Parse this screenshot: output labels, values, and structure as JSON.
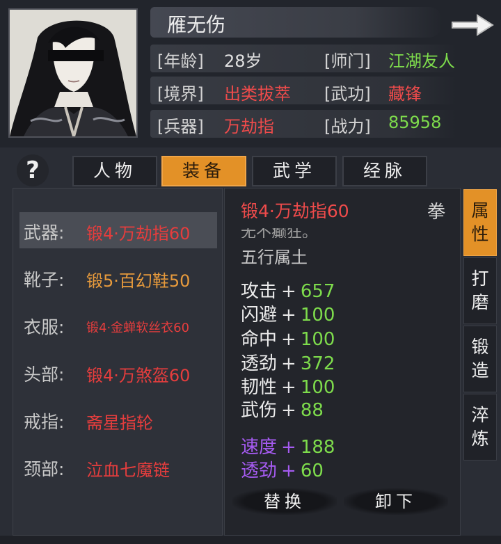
{
  "character": {
    "name": "雁无伤",
    "stats": [
      {
        "label": "[年龄]",
        "value": "28岁",
        "color": "white"
      },
      {
        "label": "[师门]",
        "value": "江湖友人",
        "color": "green"
      },
      {
        "label": "[境界]",
        "value": "出类拔萃",
        "color": "red"
      },
      {
        "label": "[武功]",
        "value": "藏锋",
        "color": "red"
      },
      {
        "label": "[兵器]",
        "value": "万劫指",
        "color": "red"
      },
      {
        "label": "[战力]",
        "value": "85958",
        "color": "green"
      }
    ]
  },
  "tabs": [
    {
      "label": "人物",
      "active": false
    },
    {
      "label": "装备",
      "active": true
    },
    {
      "label": "武学",
      "active": false
    },
    {
      "label": "经脉",
      "active": false
    }
  ],
  "help_label": "?",
  "equipment": [
    {
      "slot": "武器:",
      "item": "锻4·万劫指60",
      "color": "#e53d3d",
      "selected": true
    },
    {
      "slot": "靴子:",
      "item": "锻5·百幻鞋50",
      "color": "#e79a3c",
      "selected": false
    },
    {
      "slot": "衣服:",
      "item": "锻4·金蝉软丝衣60",
      "color": "#e53d3d",
      "selected": false
    },
    {
      "slot": "头部:",
      "item": "锻4·万煞盔60",
      "color": "#e53d3d",
      "selected": false
    },
    {
      "slot": "戒指:",
      "item": "斋星指轮",
      "color": "#e53d3d",
      "selected": false
    },
    {
      "slot": "颈部:",
      "item": "泣血七魔链",
      "color": "#e53d3d",
      "selected": false
    }
  ],
  "detail": {
    "title": "锻4·万劫指60",
    "type": "拳",
    "cut_text": "无不癫狂。",
    "element": "五行属土",
    "attributes": [
      {
        "name": "攻击",
        "value": "657",
        "special": false
      },
      {
        "name": "闪避",
        "value": "100",
        "special": false
      },
      {
        "name": "命中",
        "value": "100",
        "special": false
      },
      {
        "name": "透劲",
        "value": "372",
        "special": false
      },
      {
        "name": "韧性",
        "value": "100",
        "special": false
      },
      {
        "name": "武伤",
        "value": "88",
        "special": false
      }
    ],
    "special_attributes": [
      {
        "name": "速度",
        "value": "188",
        "special": true
      },
      {
        "name": "透劲",
        "value": "60",
        "special": true
      }
    ],
    "plus": "+",
    "replace_label": "替换",
    "unequip_label": "卸下"
  },
  "side_tabs": [
    {
      "label_1": "属",
      "label_2": "性",
      "active": true
    },
    {
      "label_1": "打",
      "label_2": "磨",
      "active": false
    },
    {
      "label_1": "锻",
      "label_2": "造",
      "active": false
    },
    {
      "label_1": "淬",
      "label_2": "炼",
      "active": false
    }
  ],
  "colors": {
    "accent": "#e39127",
    "red": "#e53d3d",
    "green": "#7edc4c",
    "purple": "#a65bf2",
    "orange": "#e79a3c"
  }
}
